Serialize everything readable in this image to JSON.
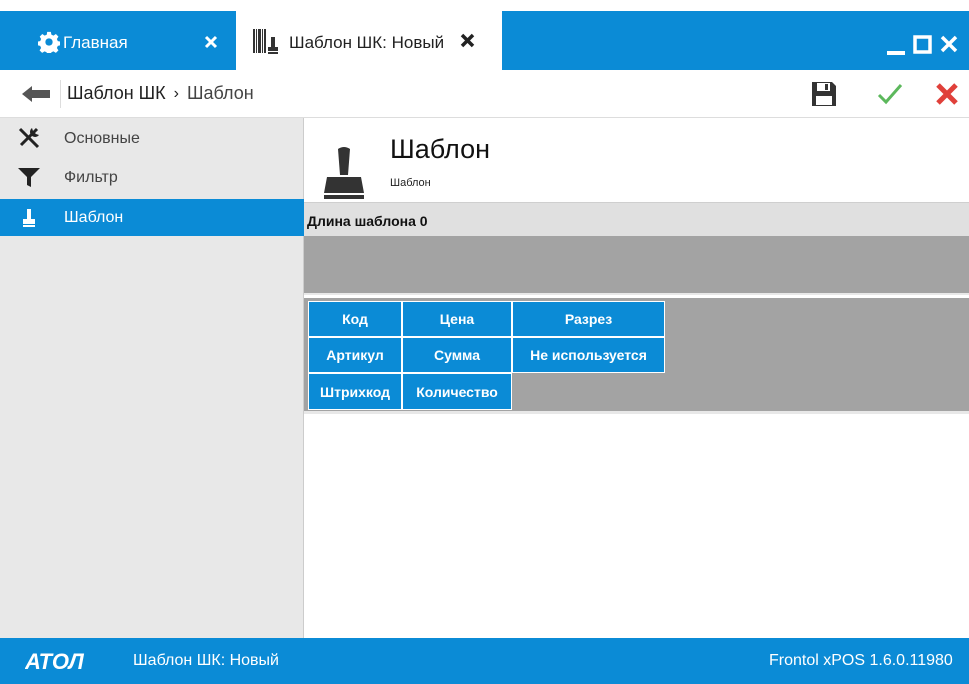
{
  "tabs": [
    {
      "label": "Главная",
      "icon": "gear-icon"
    },
    {
      "label": "Шаблон ШК: Новый",
      "icon": "barcode-stamp-icon"
    }
  ],
  "window_controls": {
    "minimize": "minimize-icon",
    "maximize": "maximize-icon",
    "close": "close-icon"
  },
  "breadcrumb": {
    "root": "Шаблон ШК",
    "separator": "›",
    "current": "Шаблон"
  },
  "toolbar": {
    "save": "save-icon",
    "ok": "checkmark-icon",
    "cancel": "cancel-icon"
  },
  "sidebar": {
    "items": [
      {
        "label": "Основные",
        "icon": "tools-icon",
        "active": false
      },
      {
        "label": "Фильтр",
        "icon": "filter-icon",
        "active": false
      },
      {
        "label": "Шаблон",
        "icon": "stamp-icon",
        "active": true
      }
    ]
  },
  "page": {
    "title": "Шаблон",
    "subtitle": "Шаблон",
    "length_label": "Длина шаблона 0"
  },
  "fields": [
    [
      "Код",
      "Цена",
      "Разрез"
    ],
    [
      "Артикул",
      "Сумма",
      "Не используется"
    ],
    [
      "Штрихкод",
      "Количество"
    ]
  ],
  "status": {
    "logo": "АТОЛ",
    "document": "Шаблон ШК: Новый",
    "version": "Frontol xPOS 1.6.0.11980"
  },
  "colors": {
    "accent": "#0b8bd6",
    "ok": "#5cb85c",
    "cancel": "#e0403a",
    "panel": "#a3a3a3"
  }
}
